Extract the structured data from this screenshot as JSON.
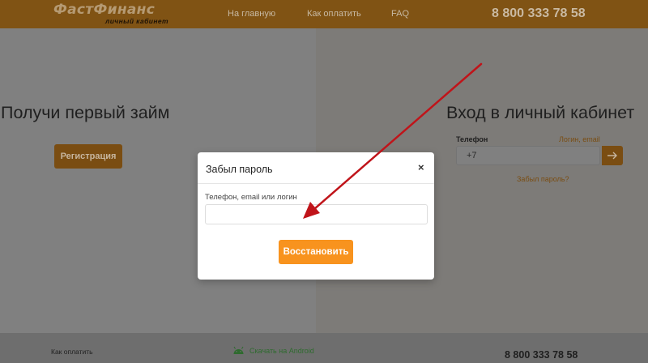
{
  "header": {
    "logo_text": "ФастФинанс",
    "logo_subtext": "личный кабинет",
    "nav": [
      "На главную",
      "Как оплатить",
      "FAQ"
    ],
    "phone": "8 800 333 78 58"
  },
  "left": {
    "title": "Получи первый займ",
    "register_button": "Регистрация"
  },
  "login": {
    "title": "Вход в личный кабинет",
    "tab_active": "Телефон",
    "tab_inactive": "Логин, email",
    "phone_value": "+7",
    "forgot_link": "Забыл пароль?"
  },
  "modal": {
    "title": "Забыл пароль",
    "close_label": "×",
    "field_label": "Телефон, email или логин",
    "field_value": "",
    "submit_button": "Восстановить"
  },
  "footer": {
    "pay_link": "Как оплатить",
    "android_link": "Скачать на Android",
    "phone": "8 800 333 78 58"
  },
  "colors": {
    "accent": "#f8931e",
    "annotation_arrow": "#c0141a"
  },
  "icons": {
    "login_submit": "arrow-right-icon",
    "android": "android-icon",
    "annotation": "red-arrow-annotation"
  }
}
